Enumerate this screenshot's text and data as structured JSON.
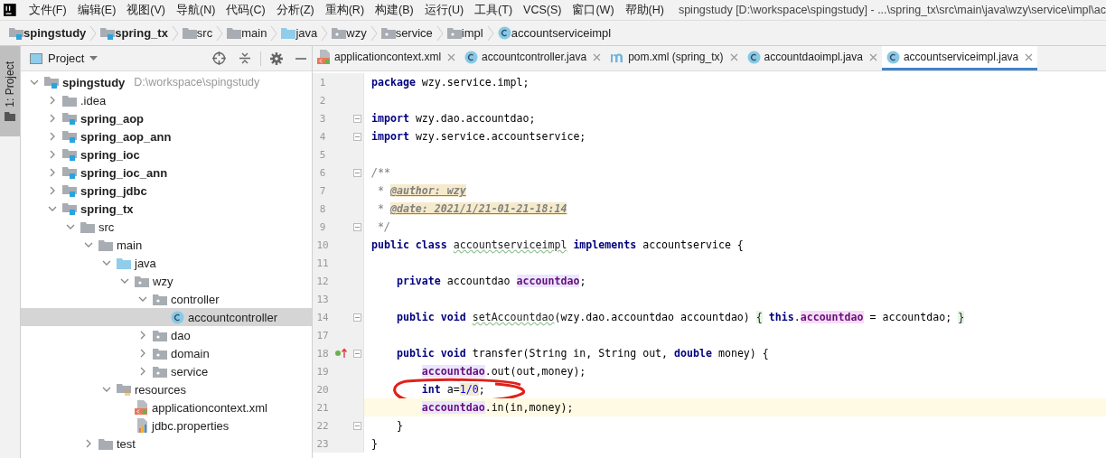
{
  "menu": {
    "items": [
      "文件(F)",
      "编辑(E)",
      "视图(V)",
      "导航(N)",
      "代码(C)",
      "分析(Z)",
      "重构(R)",
      "构建(B)",
      "运行(U)",
      "工具(T)",
      "VCS(S)",
      "窗口(W)",
      "帮助(H)"
    ],
    "title": "spingstudy [D:\\workspace\\spingstudy] - ...\\spring_tx\\src\\main\\java\\wzy\\service\\impl\\ac"
  },
  "breadcrumb": [
    {
      "label": "spingstudy",
      "kind": "module",
      "bold": true
    },
    {
      "label": "spring_tx",
      "kind": "module",
      "bold": true
    },
    {
      "label": "src",
      "kind": "folder",
      "bold": false
    },
    {
      "label": "main",
      "kind": "folder",
      "bold": false
    },
    {
      "label": "java",
      "kind": "source",
      "bold": false
    },
    {
      "label": "wzy",
      "kind": "package",
      "bold": false
    },
    {
      "label": "service",
      "kind": "package",
      "bold": false
    },
    {
      "label": "impl",
      "kind": "package",
      "bold": false
    },
    {
      "label": "accountserviceimpl",
      "kind": "class",
      "bold": false
    }
  ],
  "side_stripe": {
    "label": "1: Project",
    "selected": true
  },
  "project_panel": {
    "title": "Project",
    "tree": [
      {
        "label": "spingstudy",
        "path": "D:\\workspace\\spingstudy",
        "kind": "module",
        "bold": true,
        "expanded": true,
        "selected": false,
        "children": [
          {
            "label": ".idea",
            "kind": "folder",
            "bold": false,
            "expanded": false,
            "selected": false
          },
          {
            "label": "spring_aop",
            "kind": "module",
            "bold": true,
            "expanded": false,
            "selected": false
          },
          {
            "label": "spring_aop_ann",
            "kind": "module",
            "bold": true,
            "expanded": false,
            "selected": false
          },
          {
            "label": "spring_ioc",
            "kind": "module",
            "bold": true,
            "expanded": false,
            "selected": false
          },
          {
            "label": "spring_ioc_ann",
            "kind": "module",
            "bold": true,
            "expanded": false,
            "selected": false
          },
          {
            "label": "spring_jdbc",
            "kind": "module",
            "bold": true,
            "expanded": false,
            "selected": false
          },
          {
            "label": "spring_tx",
            "kind": "module",
            "bold": true,
            "expanded": true,
            "selected": false,
            "children": [
              {
                "label": "src",
                "kind": "folder",
                "bold": false,
                "expanded": true,
                "selected": false,
                "children": [
                  {
                    "label": "main",
                    "kind": "folder",
                    "bold": false,
                    "expanded": true,
                    "selected": false,
                    "children": [
                      {
                        "label": "java",
                        "kind": "source",
                        "bold": false,
                        "expanded": true,
                        "selected": false,
                        "children": [
                          {
                            "label": "wzy",
                            "kind": "package",
                            "bold": false,
                            "expanded": true,
                            "selected": false,
                            "children": [
                              {
                                "label": "controller",
                                "kind": "package",
                                "bold": false,
                                "expanded": true,
                                "selected": false,
                                "children": [
                                  {
                                    "label": "accountcontroller",
                                    "kind": "class",
                                    "bold": false,
                                    "selected": true
                                  }
                                ]
                              },
                              {
                                "label": "dao",
                                "kind": "package",
                                "bold": false,
                                "expanded": false,
                                "selected": false
                              },
                              {
                                "label": "domain",
                                "kind": "package",
                                "bold": false,
                                "expanded": false,
                                "selected": false
                              },
                              {
                                "label": "service",
                                "kind": "package",
                                "bold": false,
                                "expanded": false,
                                "selected": false
                              }
                            ]
                          }
                        ]
                      },
                      {
                        "label": "resources",
                        "kind": "resources",
                        "bold": false,
                        "expanded": true,
                        "selected": false,
                        "children": [
                          {
                            "label": "applicationcontext.xml",
                            "kind": "xml",
                            "bold": false,
                            "selected": false
                          },
                          {
                            "label": "jdbc.properties",
                            "kind": "properties",
                            "bold": false,
                            "selected": false
                          }
                        ]
                      }
                    ]
                  },
                  {
                    "label": "test",
                    "kind": "folder",
                    "bold": false,
                    "expanded": false,
                    "selected": false
                  }
                ]
              }
            ]
          }
        ]
      }
    ]
  },
  "tabs": [
    {
      "label": "applicationcontext.xml",
      "kind": "xml",
      "selected": false
    },
    {
      "label": "accountcontroller.java",
      "kind": "class",
      "selected": false
    },
    {
      "label": "pom.xml (spring_tx)",
      "kind": "maven",
      "selected": false
    },
    {
      "label": "accountdaoimpl.java",
      "kind": "class",
      "selected": false
    },
    {
      "label": "accountserviceimpl.java",
      "kind": "class",
      "selected": true
    }
  ],
  "code": [
    {
      "number": "1",
      "kind": "code",
      "fold": false,
      "current": false,
      "tokens": [
        {
          "kind": "kw",
          "text": "package"
        },
        {
          "kind": "plain",
          "text": " wzy.service.impl;"
        }
      ]
    },
    {
      "number": "2",
      "kind": "code",
      "fold": false,
      "current": false
    },
    {
      "number": "3",
      "kind": "code",
      "fold": true,
      "current": false,
      "tokens": [
        {
          "kind": "kw",
          "text": "import"
        },
        {
          "kind": "plain",
          "text": " wzy.dao.accountdao;"
        }
      ]
    },
    {
      "number": "4",
      "kind": "code",
      "fold": true,
      "current": false,
      "tokens": [
        {
          "kind": "kw",
          "text": "import"
        },
        {
          "kind": "plain",
          "text": " wzy.service.accountservice;"
        }
      ]
    },
    {
      "number": "5",
      "kind": "code",
      "fold": false,
      "current": false
    },
    {
      "number": "6",
      "kind": "code",
      "fold": true,
      "current": false,
      "tokens": [
        {
          "kind": "doc",
          "text": "/**"
        }
      ]
    },
    {
      "number": "7",
      "kind": "code",
      "fold": false,
      "current": false,
      "tokens": [
        {
          "kind": "doc",
          "text": " *"
        },
        {
          "kind": "doctag",
          "text": " @author: wzy"
        }
      ]
    },
    {
      "number": "8",
      "kind": "code",
      "fold": false,
      "current": false,
      "tokens": [
        {
          "kind": "doc",
          "text": " *"
        },
        {
          "kind": "doctag",
          "text": " @date: 2021/1/21-01-21-18:14"
        }
      ]
    },
    {
      "number": "9",
      "kind": "code",
      "fold": true,
      "current": false,
      "tokens": [
        {
          "kind": "doc",
          "text": " */"
        }
      ]
    },
    {
      "number": "10",
      "kind": "code",
      "fold": false,
      "current": false,
      "tokens": [
        {
          "kind": "kw",
          "text": "public class"
        },
        {
          "kind": "warn",
          "text": " accountserviceimpl"
        },
        {
          "kind": "kw",
          "text": " implements"
        },
        {
          "kind": "plain",
          "text": " accountservice {"
        }
      ]
    },
    {
      "number": "11",
      "kind": "code",
      "fold": false,
      "current": false
    },
    {
      "number": "12",
      "kind": "code",
      "fold": false,
      "current": false,
      "tokens": [
        {
          "kind": "kw",
          "text": "    private"
        },
        {
          "kind": "plain",
          "text": " accountdao"
        },
        {
          "kind": "field",
          "text": " accountdao"
        },
        {
          "kind": "plain",
          "text": ";"
        }
      ]
    },
    {
      "number": "13",
      "kind": "code",
      "fold": false,
      "current": false
    },
    {
      "number": "14",
      "kind": "code",
      "fold": true,
      "current": false,
      "tokens": [
        {
          "kind": "kw",
          "text": "    public void"
        },
        {
          "kind": "warn",
          "text": " setAccountdao"
        },
        {
          "kind": "plain",
          "text": "(wzy.dao.accountdao accountdao)"
        },
        {
          "kind": "brace",
          "text": " {"
        },
        {
          "kind": "kw",
          "text": " this"
        },
        {
          "kind": "plain",
          "text": "."
        },
        {
          "kind": "fieldhl",
          "text": "accountdao"
        },
        {
          "kind": "plain",
          "text": " = accountdao;"
        },
        {
          "kind": "brace",
          "text": " }"
        }
      ]
    },
    {
      "number": "17",
      "kind": "code",
      "fold": false,
      "current": false
    },
    {
      "number": "18",
      "kind": "implements",
      "fold": true,
      "current": false,
      "tokens": [
        {
          "kind": "kw",
          "text": "    public void"
        },
        {
          "kind": "plain",
          "text": " transfer(String in, String out,"
        },
        {
          "kind": "kw",
          "text": " double"
        },
        {
          "kind": "plain",
          "text": " money) {"
        }
      ]
    },
    {
      "number": "19",
      "kind": "code",
      "fold": false,
      "current": false,
      "tokens": [
        {
          "kind": "field",
          "text": "        accountdao"
        },
        {
          "kind": "plain",
          "text": ".out(out,money);"
        }
      ]
    },
    {
      "number": "20",
      "kind": "code",
      "fold": false,
      "current": false,
      "circled": true,
      "tokens": [
        {
          "kind": "kw",
          "text": "        int"
        },
        {
          "kind": "plain",
          "text": " a="
        },
        {
          "kind": "num",
          "text": "1/0"
        },
        {
          "kind": "plain",
          "text": ";"
        }
      ]
    },
    {
      "number": "21",
      "kind": "code",
      "fold": false,
      "current": true,
      "tokens": [
        {
          "kind": "field",
          "text": "        accountdao"
        },
        {
          "kind": "plain",
          "text": ".in(in,money);"
        }
      ]
    },
    {
      "number": "22",
      "kind": "code",
      "fold": true,
      "current": false,
      "tokens": [
        {
          "kind": "plain",
          "text": "    }"
        }
      ]
    },
    {
      "number": "23",
      "kind": "code",
      "fold": false,
      "current": false,
      "tokens": [
        {
          "kind": "plain",
          "text": "}"
        }
      ]
    }
  ],
  "annotation": {
    "kind": "ellipse"
  }
}
